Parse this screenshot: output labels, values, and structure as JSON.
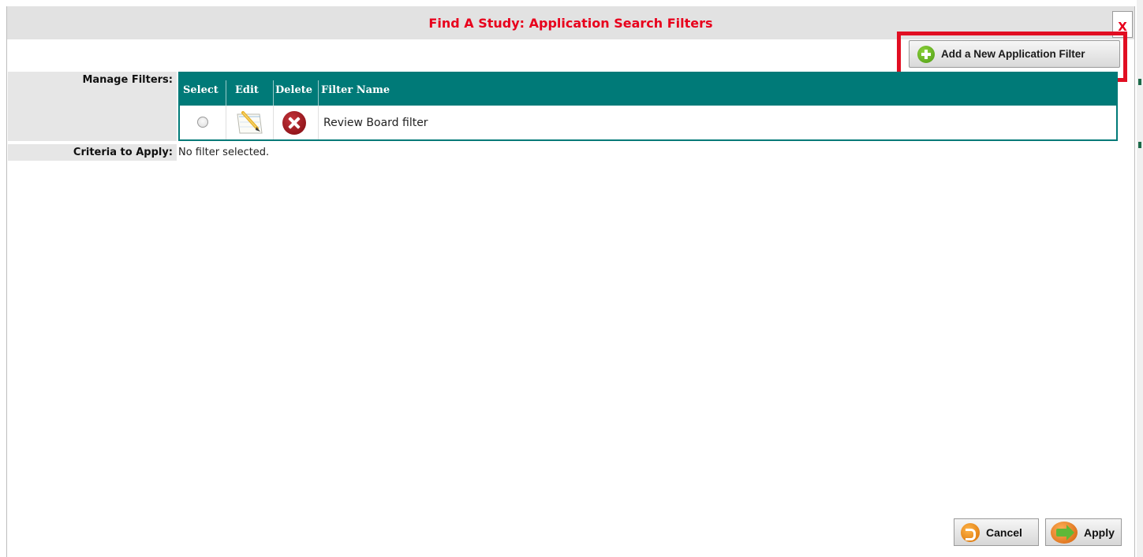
{
  "dialog": {
    "title": "Find A Study: Application Search Filters",
    "close_label": "X"
  },
  "toolbar": {
    "add_filter_label": "Add a New Application Filter"
  },
  "manage": {
    "label": "Manage Filters:",
    "columns": [
      "Select",
      "Edit",
      "Delete",
      "Filter Name"
    ],
    "rows": [
      {
        "filter_name": "Review Board filter",
        "selected": false
      }
    ]
  },
  "criteria": {
    "label": "Criteria to Apply:",
    "value": "No filter selected."
  },
  "footer": {
    "cancel_label": "Cancel",
    "apply_label": "Apply"
  },
  "colors": {
    "title_red": "#e8001c",
    "table_teal": "#007a78",
    "highlight_red": "#e10e22"
  },
  "icons": [
    "plus-icon",
    "edit-icon",
    "delete-icon",
    "cancel-icon",
    "apply-icon"
  ]
}
